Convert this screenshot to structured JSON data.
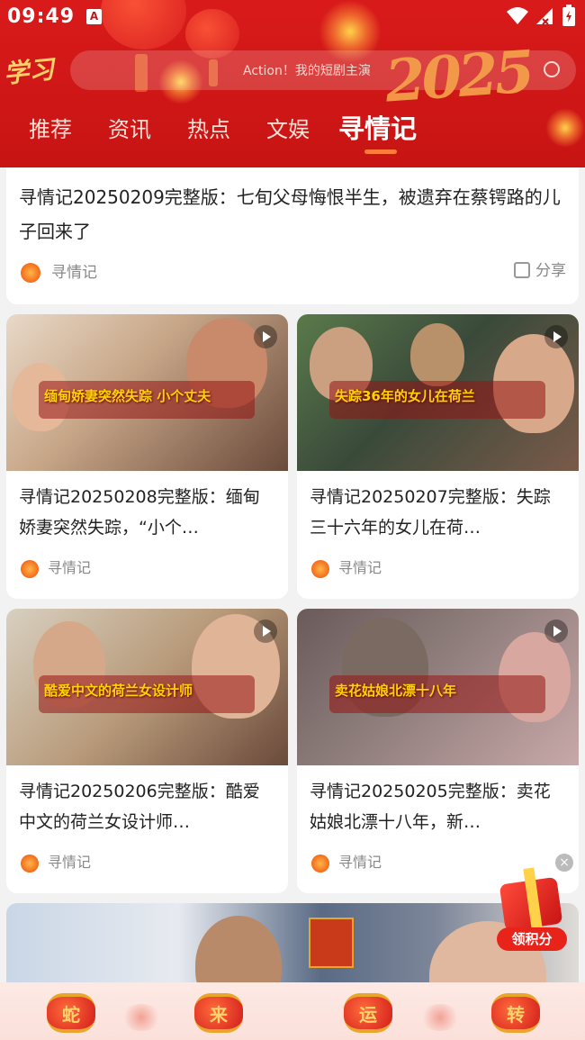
{
  "status_bar": {
    "time": "09:49",
    "notif_icon_letter": "A",
    "icons": [
      "wifi-icon",
      "signal-icon",
      "battery-icon"
    ]
  },
  "header": {
    "logo_text": "学习",
    "search_placeholder": "Action！我的短剧主演",
    "decoration_year": "2025",
    "tabs": [
      {
        "label": "推荐",
        "active": false
      },
      {
        "label": "资讯",
        "active": false
      },
      {
        "label": "热点",
        "active": false
      },
      {
        "label": "文娱",
        "active": false
      },
      {
        "label": "寻情记",
        "active": true
      }
    ]
  },
  "feed": {
    "top_card": {
      "title": "寻情记20250209完整版：七旬父母悔恨半生，被遗弃在蔡锷路的儿子回来了",
      "source": "寻情记",
      "share_label": "分享"
    },
    "cards": [
      {
        "title": "寻情记20250208完整版：缅甸娇妻突然失踪，“小个…",
        "source": "寻情记",
        "thumb_caption": "缅甸娇妻突然失踪 小个丈夫"
      },
      {
        "title": "寻情记20250207完整版：失踪三十六年的女儿在荷…",
        "source": "寻情记",
        "thumb_caption": "失踪36年的女儿在荷兰"
      },
      {
        "title": "寻情记20250206完整版：酷爱中文的荷兰女设计师…",
        "source": "寻情记",
        "thumb_caption": "酷爱中文的荷兰女设计师"
      },
      {
        "title": "寻情记20250205完整版：卖花姑娘北漂十八年，新…",
        "source": "寻情记",
        "thumb_caption": "卖花姑娘北漂十八年"
      }
    ]
  },
  "reward_float": {
    "label": "领积分",
    "close_symbol": "×"
  },
  "bottom_nav": {
    "items": [
      {
        "char": "蛇"
      },
      {
        "char": "来"
      },
      {
        "char": "运"
      },
      {
        "char": "转"
      }
    ]
  },
  "colors": {
    "header_red": "#c81414",
    "tab_indicator": "#ff7b3a",
    "reward_red": "#e8231a",
    "nav_gold": "#ffd46a"
  }
}
